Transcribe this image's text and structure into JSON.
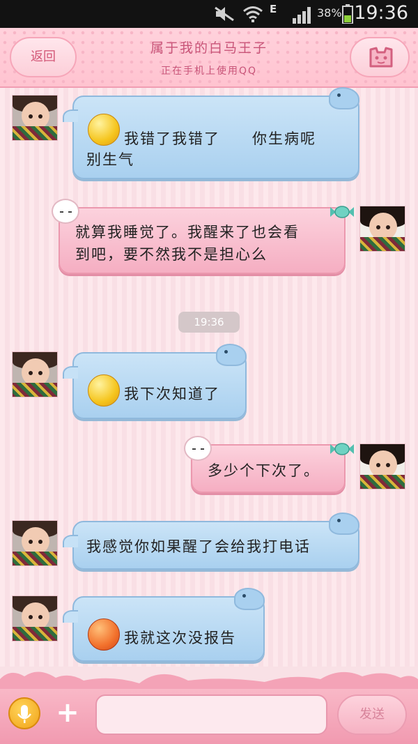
{
  "status_bar": {
    "network_label": "E",
    "battery": "38%",
    "time": "19:36"
  },
  "header": {
    "back_label": "返回",
    "title": "属于我的白马王子",
    "subtitle": "正在手机上使用QQ",
    "menu_icon": "cat-face-icon"
  },
  "messages": [
    {
      "side": "left",
      "color": "blue",
      "emoji": "sweat-face",
      "lines": [
        "我错了我错了　　你生病呢",
        "别生气"
      ]
    },
    {
      "side": "right",
      "color": "pink",
      "lines": [
        "就算我睡觉了。我醒来了也会看",
        "到吧，要不然我不是担心么"
      ]
    },
    {
      "side": "left",
      "color": "blue",
      "emoji": "shocked-face",
      "lines": [
        "我下次知道了"
      ]
    },
    {
      "side": "right",
      "color": "pink",
      "lines": [
        "多少个下次了。"
      ]
    },
    {
      "side": "left",
      "color": "blue",
      "lines": [
        "我感觉你如果醒了会给我打电话"
      ]
    },
    {
      "side": "left",
      "color": "blue",
      "emoji": "crying-face",
      "lines": [
        "我就这次没报告"
      ]
    }
  ],
  "time_divider": "19:36",
  "input_bar": {
    "placeholder": "",
    "send_label": "发送",
    "mic_icon": "microphone-icon",
    "plus_icon": "plus-icon"
  },
  "colors": {
    "header_pink": "#ffc3d0",
    "bubble_blue": "#a9d0ef",
    "bubble_pink": "#f5aec2",
    "accent_text": "#c85478"
  }
}
